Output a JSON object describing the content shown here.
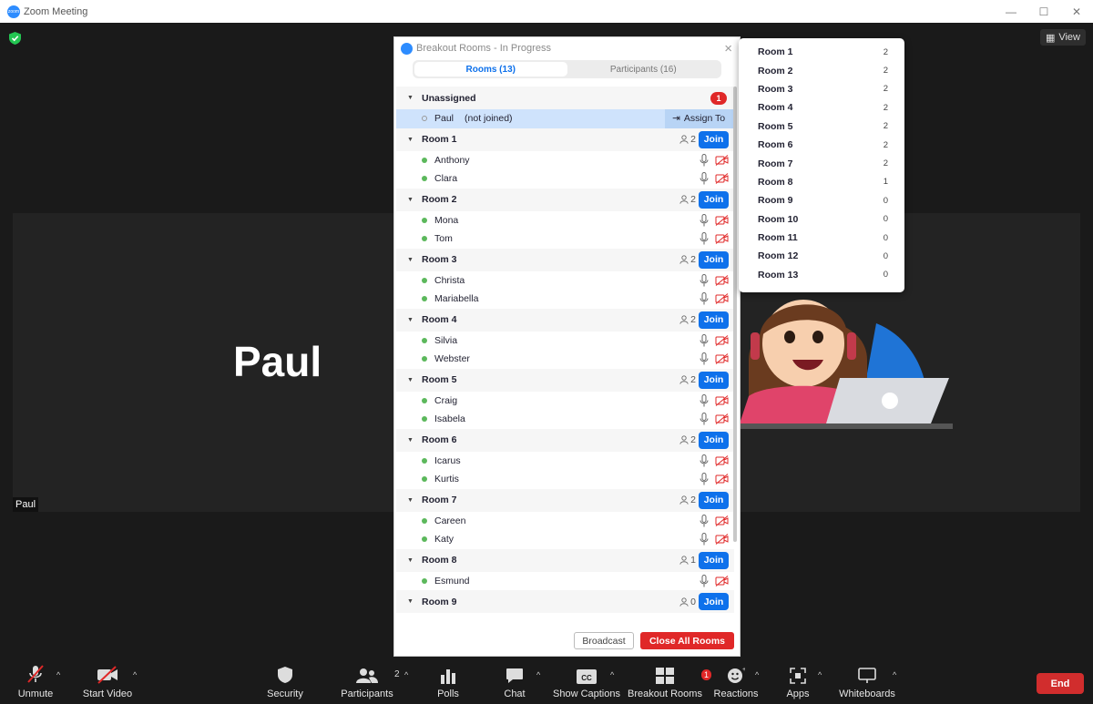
{
  "window": {
    "title": "Zoom Meeting",
    "controls": [
      "—",
      "☐",
      "✕"
    ]
  },
  "meeting": {
    "view_label": "View",
    "speaker_name": "Paul",
    "name_tag": "Paul"
  },
  "breakout": {
    "title": "Breakout Rooms - In Progress",
    "tabs": [
      {
        "label": "Rooms (13)",
        "active": true
      },
      {
        "label": "Participants (16)",
        "active": false
      }
    ],
    "unassigned": {
      "label": "Unassigned",
      "count": "1",
      "member": {
        "name": "Paul",
        "status": "(not joined)",
        "action": "Assign To"
      }
    },
    "rooms": [
      {
        "name": "Room 1",
        "count": "2",
        "members": [
          "Anthony",
          "Clara"
        ]
      },
      {
        "name": "Room 2",
        "count": "2",
        "members": [
          "Mona",
          "Tom"
        ]
      },
      {
        "name": "Room 3",
        "count": "2",
        "members": [
          "Christa",
          "Mariabella"
        ]
      },
      {
        "name": "Room 4",
        "count": "2",
        "members": [
          "Silvia",
          "Webster"
        ]
      },
      {
        "name": "Room 5",
        "count": "2",
        "members": [
          "Craig",
          "Isabela"
        ]
      },
      {
        "name": "Room 6",
        "count": "2",
        "members": [
          "Icarus",
          "Kurtis"
        ]
      },
      {
        "name": "Room 7",
        "count": "2",
        "members": [
          "Careen",
          "Katy"
        ]
      },
      {
        "name": "Room 8",
        "count": "1",
        "members": [
          "Esmund"
        ]
      },
      {
        "name": "Room 9",
        "count": "0",
        "members": []
      }
    ],
    "join_label": "Join",
    "broadcast_label": "Broadcast",
    "close_all_label": "Close All Rooms"
  },
  "assign_menu": [
    {
      "name": "Room 1",
      "count": "2"
    },
    {
      "name": "Room 2",
      "count": "2"
    },
    {
      "name": "Room 3",
      "count": "2"
    },
    {
      "name": "Room 4",
      "count": "2"
    },
    {
      "name": "Room 5",
      "count": "2"
    },
    {
      "name": "Room 6",
      "count": "2"
    },
    {
      "name": "Room 7",
      "count": "2"
    },
    {
      "name": "Room 8",
      "count": "1"
    },
    {
      "name": "Room 9",
      "count": "0"
    },
    {
      "name": "Room 10",
      "count": "0"
    },
    {
      "name": "Room 11",
      "count": "0"
    },
    {
      "name": "Room 12",
      "count": "0"
    },
    {
      "name": "Room 13",
      "count": "0"
    }
  ],
  "toolbar": {
    "unmute": "Unmute",
    "start_video": "Start Video",
    "security": "Security",
    "participants": "Participants",
    "participants_count": "2",
    "polls": "Polls",
    "chat": "Chat",
    "captions": "Show Captions",
    "breakout": "Breakout Rooms",
    "breakout_badge": "1",
    "reactions": "Reactions",
    "apps": "Apps",
    "whiteboards": "Whiteboards",
    "end": "End"
  },
  "colors": {
    "accent": "#0e71eb",
    "danger": "#e02828",
    "online": "#5cb85c"
  }
}
